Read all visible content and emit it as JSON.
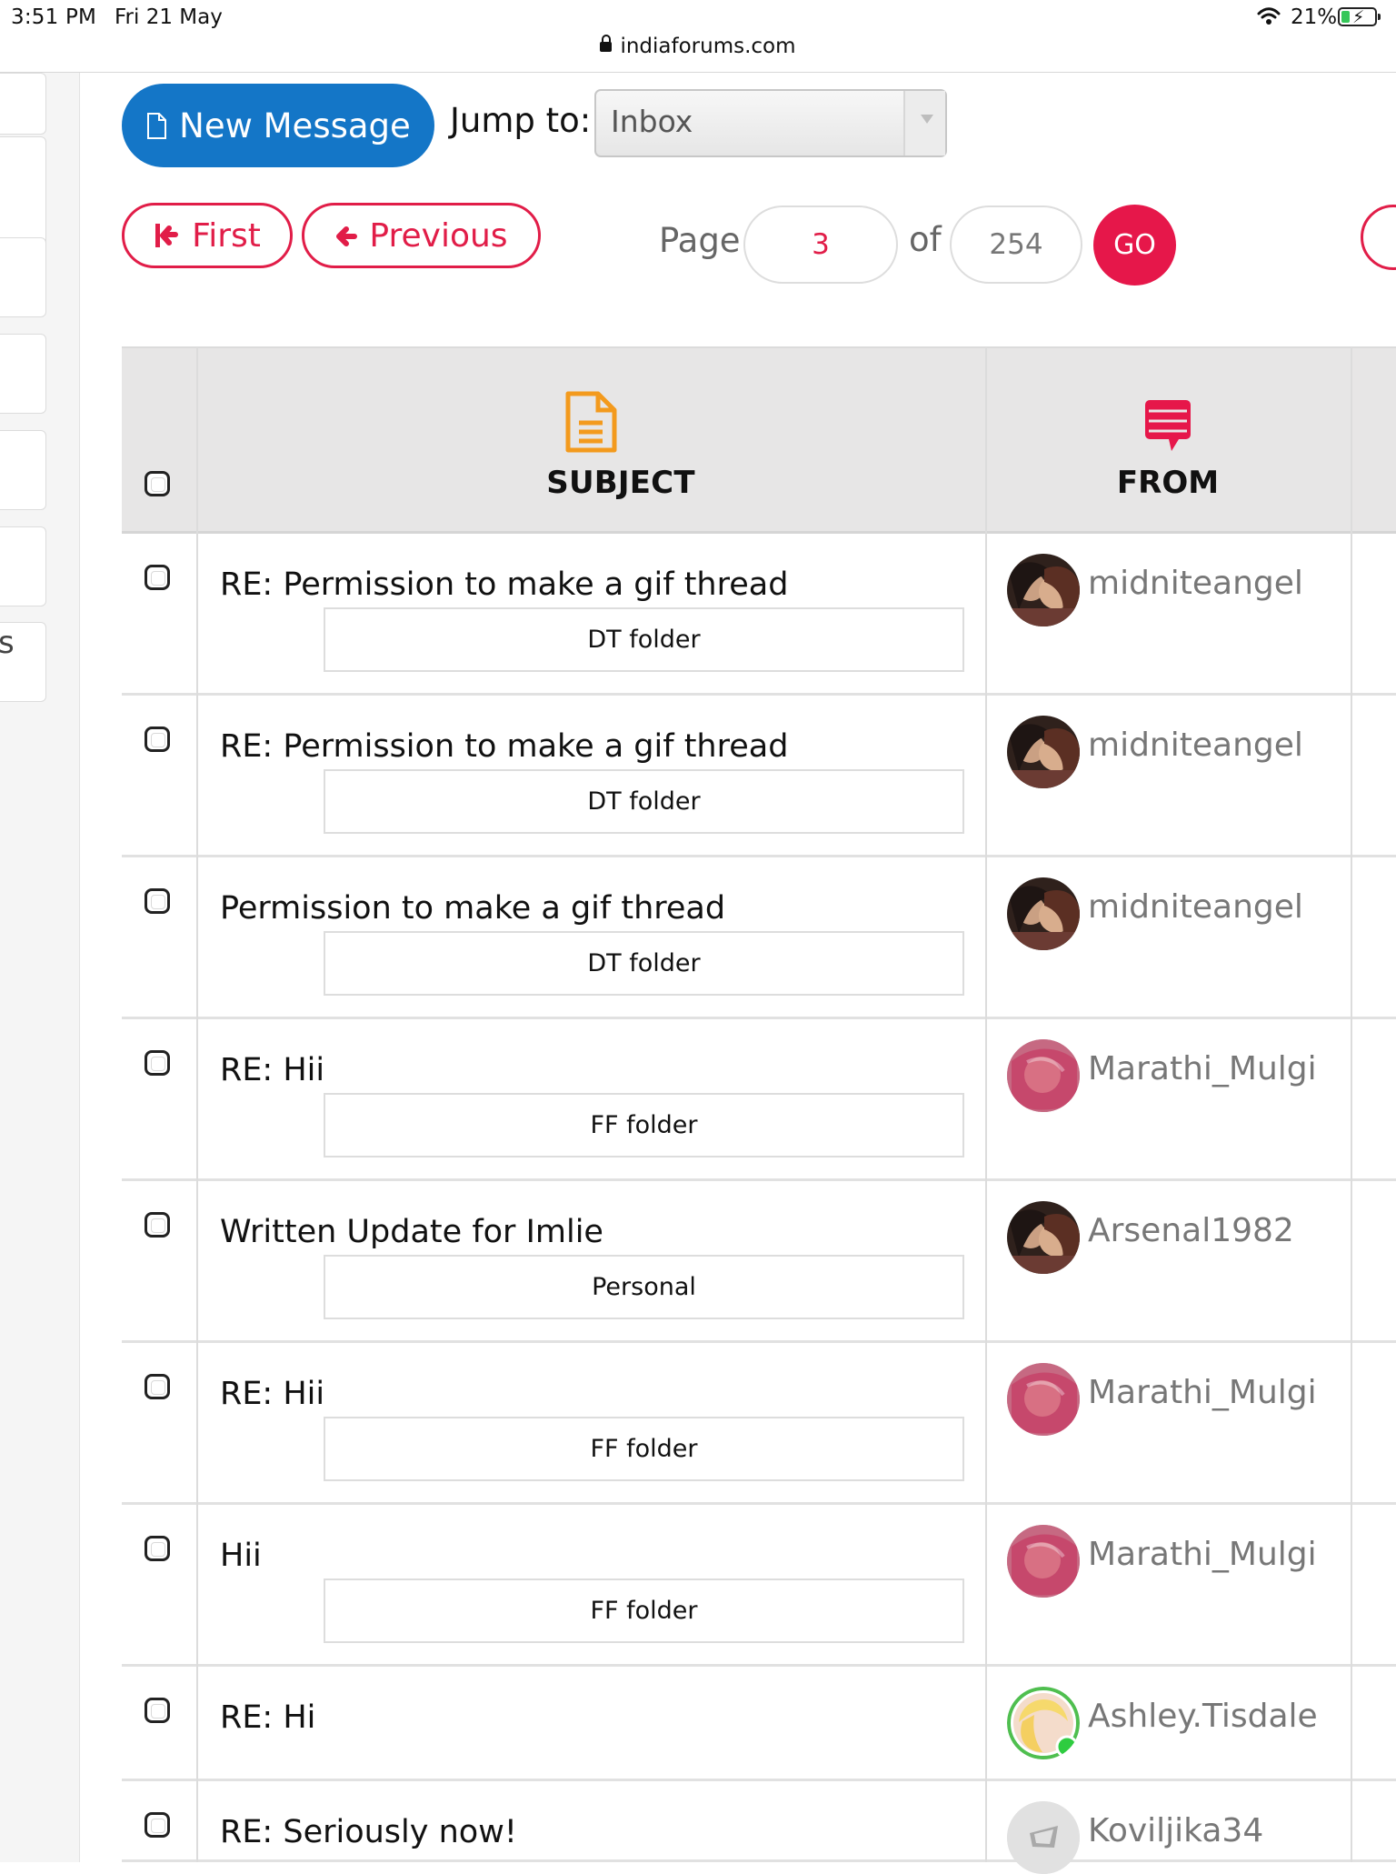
{
  "status_bar": {
    "time": "3:51 PM",
    "date": "Fri 21 May",
    "url": "indiaforums.com",
    "battery": "21%"
  },
  "toolbar": {
    "new_message": "New Message",
    "jump_to": "Jump to:",
    "folder_selected": "Inbox"
  },
  "pagination": {
    "first": "First",
    "previous": "Previous",
    "page_label": "Page",
    "page_value": "3",
    "of_label": "of",
    "total_pages": "254",
    "go": "GO"
  },
  "table": {
    "headers": {
      "subject": "SUBJECT",
      "from": "FROM"
    },
    "rows": [
      {
        "subject": "RE: Permission to make a gif thread",
        "folder": "DT folder",
        "sender": "midniteangel",
        "avatar": "couple-photo"
      },
      {
        "subject": "RE: Permission to make a gif thread",
        "folder": "DT folder",
        "sender": "midniteangel",
        "avatar": "couple-photo"
      },
      {
        "subject": "Permission to make a gif thread",
        "folder": "DT folder",
        "sender": "midniteangel",
        "avatar": "couple-photo"
      },
      {
        "subject": "RE: Hii",
        "folder": "FF folder",
        "sender": "Marathi_Mulgi",
        "avatar": "pink-veil-photo"
      },
      {
        "subject": "Written Update for Imlie",
        "folder": "Personal",
        "sender": "Arsenal1982",
        "avatar": "couple-photo"
      },
      {
        "subject": "RE: Hii",
        "folder": "FF folder",
        "sender": "Marathi_Mulgi",
        "avatar": "pink-veil-photo"
      },
      {
        "subject": "Hii",
        "folder": "FF folder",
        "sender": "Marathi_Mulgi",
        "avatar": "pink-veil-photo"
      },
      {
        "subject": "RE: Hi",
        "folder": "",
        "sender": "Ashley.Tisdale",
        "avatar": "blonde-photo-online"
      },
      {
        "subject": "RE: Seriously now!",
        "folder": "",
        "sender": "Koviljika34",
        "avatar": "default-avatar"
      }
    ]
  },
  "left_rail": {
    "visible_text": "s"
  },
  "colors": {
    "blue": "#1476c7",
    "red": "#e6174a",
    "header_gray": "#e7e6e6",
    "online_green": "#2ecc40"
  }
}
